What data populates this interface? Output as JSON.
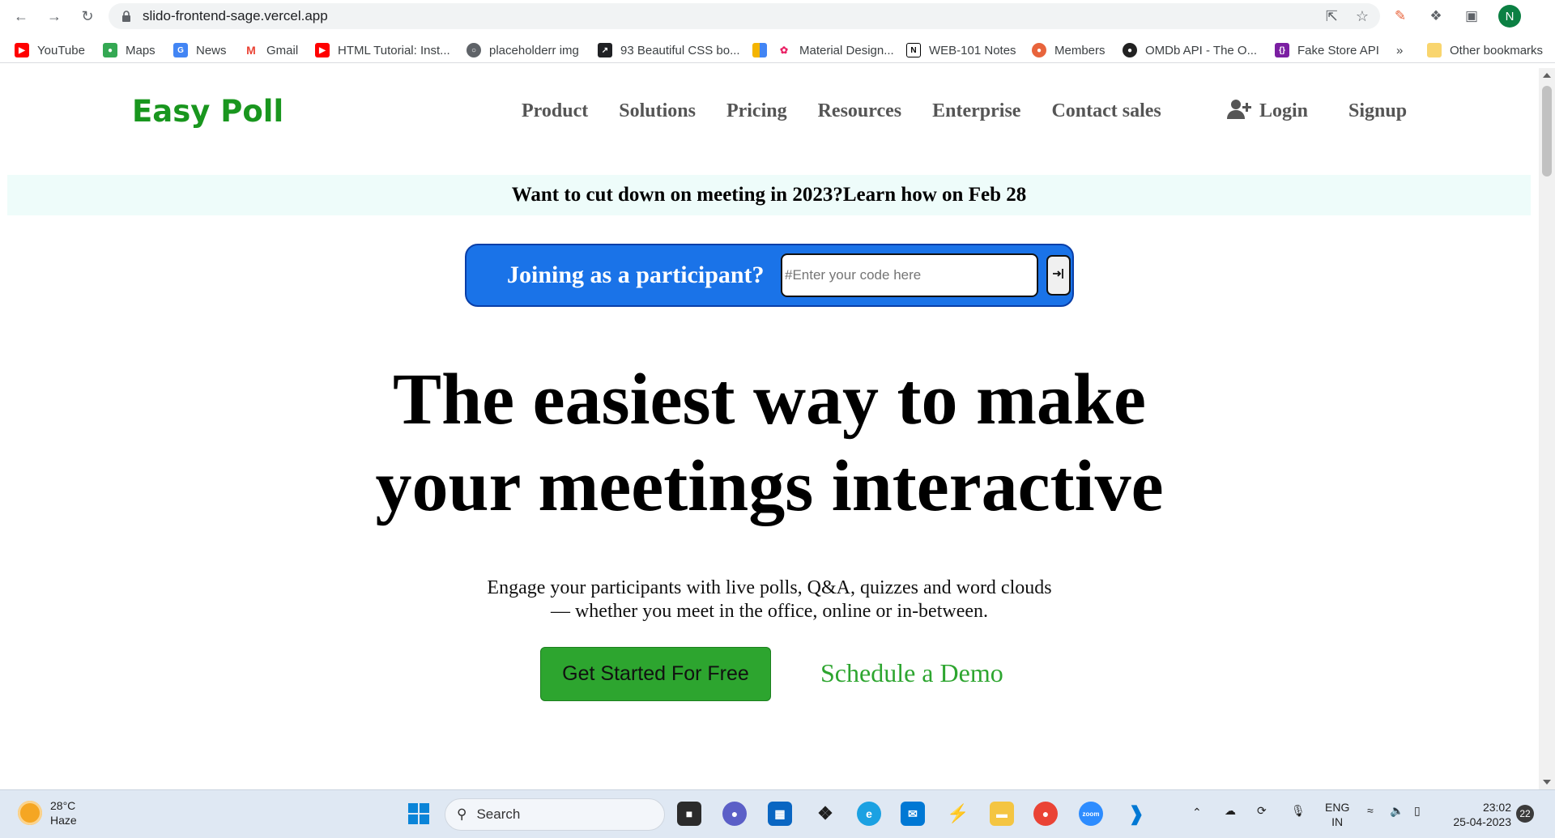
{
  "browser": {
    "url": "slido-frontend-sage.vercel.app",
    "profile_initial": "N",
    "bookmarks": [
      {
        "label": "YouTube",
        "icon": "youtube-icon",
        "color": "#ff0000"
      },
      {
        "label": "Maps",
        "icon": "maps-icon",
        "color": "#34a853"
      },
      {
        "label": "News",
        "icon": "news-icon",
        "color": "#4285f4"
      },
      {
        "label": "Gmail",
        "icon": "gmail-icon",
        "color": "#ea4335"
      },
      {
        "label": "HTML Tutorial: Inst...",
        "icon": "youtube-icon",
        "color": "#ff0000"
      },
      {
        "label": "placeholderr img",
        "icon": "globe-icon",
        "color": "#5f6368"
      },
      {
        "label": "93 Beautiful CSS bo...",
        "icon": "cursor-icon",
        "color": "#202124"
      },
      {
        "label": "Material Design...",
        "icon": "material-icon",
        "color": "#e91e63"
      },
      {
        "label": "WEB-101 Notes",
        "icon": "notion-icon",
        "color": "#000000"
      },
      {
        "label": "Members",
        "icon": "members-icon",
        "color": "#e8643c"
      },
      {
        "label": "OMDb API - The O...",
        "icon": "omdb-icon",
        "color": "#222222"
      },
      {
        "label": "Fake Store API",
        "icon": "fakestore-icon",
        "color": "#7b1fa2"
      }
    ],
    "more_bookmarks": "»",
    "other_bookmarks": "Other bookmarks"
  },
  "site": {
    "brand": "Easy Poll",
    "nav": [
      "Product",
      "Solutions",
      "Pricing",
      "Resources",
      "Enterprise",
      "Contact sales"
    ],
    "login": "Login",
    "signup": "Signup",
    "announcement": "Want to cut down on meeting in 2023?Learn how on Feb 28",
    "join": {
      "label": "Joining as a participant?",
      "placeholder": "#Enter your code here"
    },
    "hero_line1": "The easiest way to make",
    "hero_line2": "your meetings interactive",
    "sub_line1": "Engage your participants with live polls, Q&A, quizzes and word clouds",
    "sub_line2": "— whether you meet in the office, online or in-between.",
    "cta": "Get Started For Free",
    "demo": "Schedule a Demo",
    "colors": {
      "brand": "#19961e",
      "join_bg": "#1a73e8",
      "cta_bg": "#2da52f"
    }
  },
  "taskbar": {
    "temp": "28°C",
    "weather": "Haze",
    "search": "Search",
    "lang_top": "ENG",
    "lang_bottom": "IN",
    "time": "23:02",
    "date": "25-04-2023",
    "notifications": "22"
  }
}
